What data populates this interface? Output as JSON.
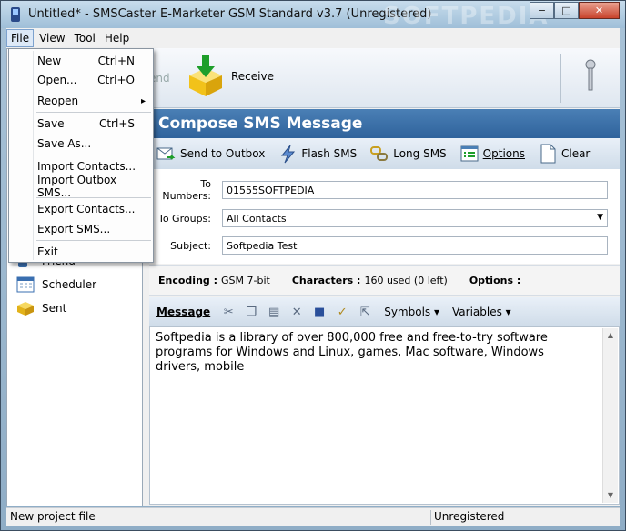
{
  "window": {
    "title": "Untitled* - SMSCaster E-Marketer GSM Standard v3.7 (Unregistered)",
    "watermark": "SOFTPEDIA",
    "minimize_glyph": "−",
    "maximize_glyph": "□",
    "close_glyph": "✕"
  },
  "menubar": {
    "items": [
      "File",
      "View",
      "Tool",
      "Help"
    ]
  },
  "file_menu": {
    "items": [
      {
        "label": "New",
        "shortcut": "Ctrl+N"
      },
      {
        "label": "Open...",
        "shortcut": "Ctrl+O"
      },
      {
        "label": "Reopen",
        "submenu": "▸"
      },
      {
        "label": "Save",
        "shortcut": "Ctrl+S"
      },
      {
        "label": "Save As..."
      },
      {
        "label": "Import Contacts..."
      },
      {
        "label": "Import Outbox SMS..."
      },
      {
        "label": "Export Contacts..."
      },
      {
        "label": "Export SMS..."
      },
      {
        "label": "Exit"
      }
    ]
  },
  "sidebar": {
    "items": [
      {
        "label": "Friend",
        "icon": "contacts-icon"
      },
      {
        "label": "Scheduler",
        "icon": "calendar-icon"
      },
      {
        "label": "Sent",
        "icon": "box-icon"
      }
    ]
  },
  "toolbar": {
    "send_label": "end",
    "receive_label": "Receive"
  },
  "compose": {
    "header": "Compose SMS Message",
    "actions": [
      "Send to Outbox",
      "Flash SMS",
      "Long SMS",
      "Options",
      "Clear"
    ]
  },
  "form": {
    "to_numbers_label": "To Numbers:",
    "to_numbers_value": "01555SOFTPEDIA",
    "to_groups_label": "To Groups:",
    "to_groups_value": "All Contacts",
    "subject_label": "Subject:",
    "subject_value": "Softpedia Test"
  },
  "info": {
    "encoding_label": "Encoding :",
    "encoding_value": "GSM 7-bit",
    "characters_label": "Characters :",
    "characters_value": "160 used (0 left)",
    "options_label": "Options :"
  },
  "message_toolbar": {
    "label": "Message",
    "symbols": "Symbols",
    "variables": "Variables"
  },
  "message": {
    "body": "Softpedia is a library of over 800,000 free and free-to-try software programs for Windows and Linux, games, Mac software, Windows drivers, mobile"
  },
  "statusbar": {
    "left": "New project file",
    "right": "Unregistered"
  },
  "colors": {
    "header_blue": "#2f639c",
    "receive_yellow": "#f2c21a",
    "arrow_green": "#1e9e2a"
  }
}
